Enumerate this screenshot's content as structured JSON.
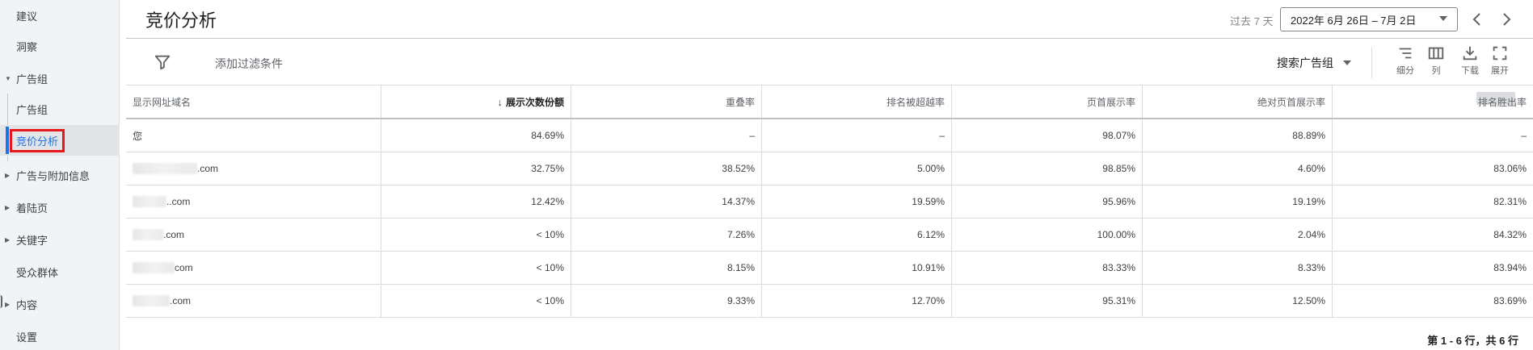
{
  "sidebar": {
    "items": [
      {
        "label": "建议",
        "type": "plain"
      },
      {
        "label": "洞察",
        "type": "plain"
      },
      {
        "label": "广告组",
        "type": "group"
      },
      {
        "label": "广告组",
        "type": "sub"
      },
      {
        "label": "竞价分析",
        "type": "sub",
        "active": true
      },
      {
        "label": "广告与附加信息",
        "type": "group"
      },
      {
        "label": "着陆页",
        "type": "group"
      },
      {
        "label": "关键字",
        "type": "group"
      },
      {
        "label": "受众群体",
        "type": "plain"
      },
      {
        "label": "内容",
        "type": "group"
      },
      {
        "label": "设置",
        "type": "plain"
      }
    ]
  },
  "header": {
    "title": "竞价分析",
    "range_prefix": "过去 7 天",
    "date_range": "2022年 6月 26日 – 7月 2日"
  },
  "toolbar": {
    "filter_label": "添加过滤条件",
    "segment_select": "搜索广告组",
    "tools": [
      {
        "label": "细分",
        "icon": "segment-icon"
      },
      {
        "label": "列",
        "icon": "columns-icon"
      },
      {
        "label": "下载",
        "icon": "download-icon"
      },
      {
        "label": "展开",
        "icon": "fullscreen-icon"
      }
    ]
  },
  "table": {
    "columns": [
      "显示网址域名",
      "展示次数份额",
      "重叠率",
      "排名被超越率",
      "页首展示率",
      "绝对页首展示率",
      "排名胜出率"
    ],
    "sorted_column": "展示次数份额",
    "rows": [
      [
        "您",
        "84.69%",
        "–",
        "–",
        "98.07%",
        "88.89%",
        "–"
      ],
      [
        ".com",
        "32.75%",
        "38.52%",
        "5.00%",
        "98.85%",
        "4.60%",
        "83.06%"
      ],
      [
        "..com",
        "12.42%",
        "14.37%",
        "19.59%",
        "95.96%",
        "19.19%",
        "82.31%"
      ],
      [
        ".com",
        "< 10%",
        "7.26%",
        "6.12%",
        "100.00%",
        "2.04%",
        "84.32%"
      ],
      [
        "com",
        "< 10%",
        "8.15%",
        "10.91%",
        "83.33%",
        "8.33%",
        "83.94%"
      ],
      [
        ".com",
        "< 10%",
        "9.33%",
        "12.70%",
        "95.31%",
        "12.50%",
        "83.69%"
      ]
    ]
  },
  "footer": {
    "row_count": "第 1 - 6 行，共 6 行"
  },
  "colors": {
    "accent": "#1a73e8",
    "highlight_box": "#e8161b",
    "sidebar_bg": "#f1f3f4"
  }
}
